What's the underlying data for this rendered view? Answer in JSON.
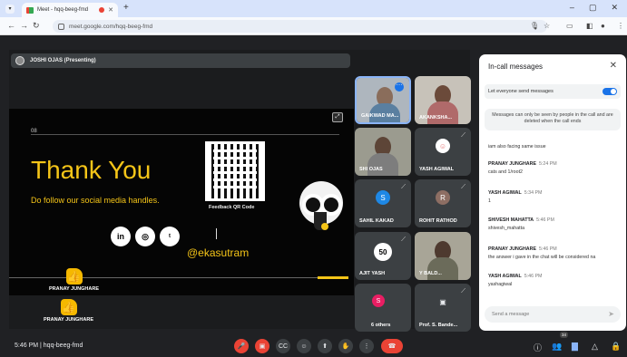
{
  "browser": {
    "tab_title": "Meet - hqq-beeg-fmd",
    "url": "meet.google.com/hqq-beeg-fmd"
  },
  "presenter_label": "JOSHI OJAS (Presenting)",
  "slide": {
    "number": "08",
    "title": "Thank You",
    "subtitle": "Do follow our social media handles.",
    "qr_caption": "Feedback QR Code",
    "handle": "@ekasutram",
    "social": [
      "in",
      "◎",
      "ᵗ"
    ]
  },
  "reactions": [
    "PRANAY JUNGHARE",
    "PRANAY JUNGHARE"
  ],
  "tiles": [
    {
      "name": "GAIKWAD MA...",
      "kind": "photo",
      "accent": "#5a7fa0"
    },
    {
      "name": "AKANKSHA...",
      "kind": "photo",
      "accent": "#b06a6a"
    },
    {
      "name": "SHI OJAS",
      "kind": "photo",
      "accent": "#7d7d7d"
    },
    {
      "name": "YASH AGIWAL",
      "kind": "avatar",
      "letter": "",
      "color": "#ffffff"
    },
    {
      "name": "SAHIL KAKAD",
      "kind": "avatar",
      "letter": "S",
      "color": "#1e88e5"
    },
    {
      "name": "ROHIT RATHOD",
      "kind": "avatar",
      "letter": "R",
      "color": "#8d6e63"
    },
    {
      "name": "AJIT YASH",
      "kind": "avatar",
      "letter": "50",
      "color": "#ffffff"
    },
    {
      "name": "Y BALD...",
      "kind": "photo",
      "accent": "#6b6b5a"
    },
    {
      "name": "6 others",
      "kind": "avatar",
      "letter": "S",
      "color": "#e91e63"
    },
    {
      "name": "Prof. S. Bande...",
      "kind": "avatar",
      "letter": "▣",
      "color": "#5f6368"
    }
  ],
  "panel": {
    "title": "In-call messages",
    "toggle_label": "Let everyone send messages",
    "notice": "Messages can only be seen by people in the call and are deleted when the call ends",
    "partial_text": "iam also facing same issue",
    "messages": [
      {
        "who": "PRANAY JUNGHARE",
        "time": "5:24 PM",
        "text": "cats and 1/root2"
      },
      {
        "who": "YASH AGIWAL",
        "time": "5:34 PM",
        "text": "1"
      },
      {
        "who": "SHIVESH MAHATTA",
        "time": "5:46 PM",
        "text": "shivesh_mahatta"
      },
      {
        "who": "PRANAY JUNGHARE",
        "time": "5:46 PM",
        "text": "the answer i gave in the chat will be considered na"
      },
      {
        "who": "YASH AGIWAL",
        "time": "5:46 PM",
        "text": "yashagiwal"
      }
    ],
    "send_placeholder": "Send a message"
  },
  "bottom": {
    "clock": "5:46 PM | hqq-beeg-fmd",
    "people_count": "34"
  },
  "colors": {
    "accent_yellow": "#f5c518",
    "end_call_red": "#ea4335",
    "meet_dark": "#202124"
  }
}
